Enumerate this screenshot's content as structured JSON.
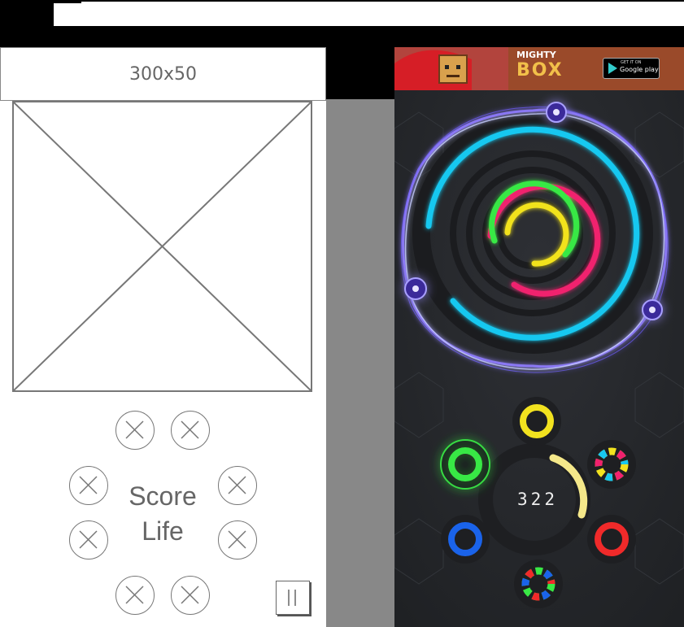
{
  "ad_placeholder": {
    "label": "300x50"
  },
  "hud": {
    "score_label": "Score",
    "life_label": "Life"
  },
  "banner": {
    "title_top": "MIGHTY",
    "title_bottom": "BOX",
    "store_small": "GET IT ON",
    "store_label": "Google play"
  },
  "game": {
    "score": "322"
  },
  "colors": {
    "cyan": "#17c8f0",
    "magenta": "#f0216e",
    "green": "#39e845",
    "yellow": "#f2e21f",
    "red": "#f02a2a",
    "blue": "#1a63ea",
    "lightning": "#8f7bff",
    "background": "#26282c"
  },
  "icons": [
    "close-circle-icon",
    "pause-icon",
    "image-placeholder-icon",
    "electric-orb-icon",
    "rainbow-ring-icon"
  ]
}
